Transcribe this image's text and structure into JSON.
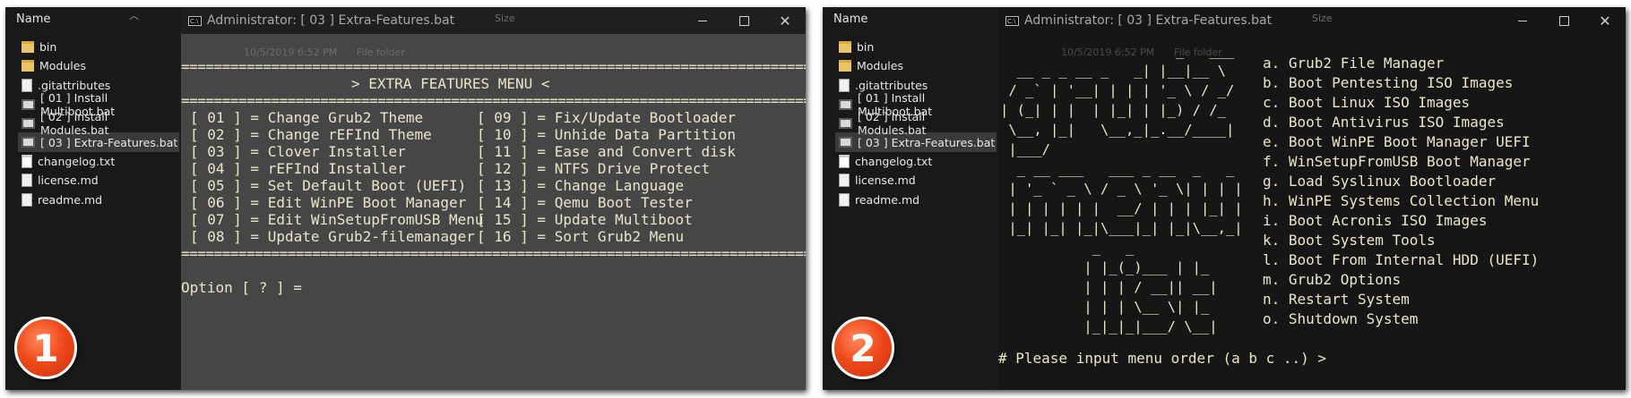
{
  "explorer": {
    "column_header": "Name",
    "sort_icon": "chevron-up-icon",
    "items": [
      {
        "label": "bin",
        "icon": "folder-icon"
      },
      {
        "label": "Modules",
        "icon": "folder-icon"
      },
      {
        "label": ".gitattributes",
        "icon": "file-icon"
      },
      {
        "label": "[ 01 ] Install Multiboot.bat",
        "icon": "batch-file-icon"
      },
      {
        "label": "[ 02 ] Install Modules.bat",
        "icon": "batch-file-icon"
      },
      {
        "label": "[ 03 ] Extra-Features.bat",
        "icon": "batch-file-icon"
      },
      {
        "label": "changelog.txt",
        "icon": "text-file-icon"
      },
      {
        "label": "license.md",
        "icon": "file-icon"
      },
      {
        "label": "readme.md",
        "icon": "file-icon"
      }
    ]
  },
  "window": {
    "title": "Administrator:  [ 03 ] Extra-Features.bat"
  },
  "ghost_text": {
    "size_header": "Size",
    "date1": "10/5/2019 6:52 PM",
    "type1": "File folder"
  },
  "terminal1": {
    "separator": "==========================================================================================================================================",
    "menu_title": "> EXTRA FEATURES MENU <",
    "left_options": [
      "[ 01 ] = Change Grub2 Theme",
      "[ 02 ] = Change rEFInd Theme",
      "[ 03 ] = Clover Installer",
      "[ 04 ] = rEFInd Installer",
      "[ 05 ] = Set Default Boot (UEFI)",
      "[ 06 ] = Edit WinPE Boot Manager",
      "[ 07 ] = Edit WinSetupFromUSB Menu",
      "[ 08 ] = Update Grub2-filemanager"
    ],
    "right_options": [
      "[ 09 ] = Fix/Update Bootloader",
      "[ 10 ] = Unhide Data Partition",
      "[ 11 ] = Ease and Convert disk",
      "[ 12 ] = NTFS Drive Protect",
      "[ 13 ] = Change Language",
      "[ 14 ] = Qemu Boot Tester",
      "[ 15 ] = Update Multiboot",
      "[ 16 ] = Sort Grub2 Menu"
    ],
    "prompt": "Option [ ? ] ="
  },
  "terminal2": {
    "ascii_art": "                     _   ___\n  __ _ _ __ _   _| |__|__ \\\n / _` | '__| | | | '_ \\ / _/\n| (_| | |  | |_| | |_) / /_\n \\__, |_|   \\__,_|_.__/____|\n |___/\n  _ __ ___   ___ _ __  _   _\n | '_ ` _ \\ / _ \\ '_ \\| | | |\n | | | | | |  __/ | | | |_| |\n |_| |_| |_|\\___|_| |_|\\__,_|\n           _   _\n          | |_(_)___ | |_\n          | | | / __|| __|\n          | | | \\__ \\| |_\n          |_|_|_|___/ \\__|",
    "options": [
      "a. Grub2 File Manager",
      "b. Boot Pentesting ISO Images",
      "c. Boot Linux ISO Images",
      "d. Boot Antivirus ISO Images",
      "e. Boot WinPE Boot Manager UEFI",
      "f. WinSetupFromUSB Boot Manager",
      "g. Load Syslinux Bootloader",
      "h. WinPE Systems Collection Menu",
      "i. Boot Acronis ISO Images",
      "k. Boot System Tools",
      "l. Boot From Internal HDD (UEFI)",
      "m. Grub2 Options",
      "n. Restart System",
      "o. Shutdown System"
    ],
    "prompt": "# Please input menu order (a b c ..) >"
  },
  "badges": {
    "first": "1",
    "second": "2"
  },
  "colors": {
    "console_bg": "#464646",
    "console_text": "#eae6c7",
    "badge": "#f04a1a"
  }
}
